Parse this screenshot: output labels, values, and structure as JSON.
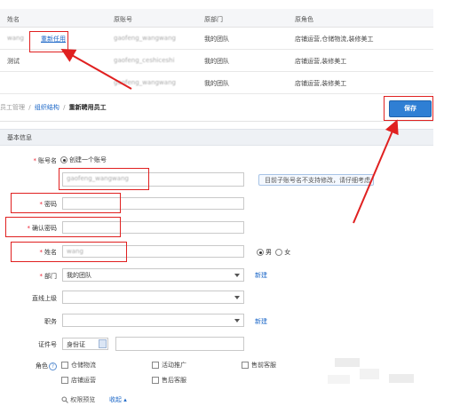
{
  "table": {
    "headers": [
      "姓名",
      "原账号",
      "原部门",
      "原角色"
    ],
    "rows": [
      {
        "name": "wang",
        "action": "重新任用",
        "account": "gaofeng_wangwang",
        "dept": "我的团队",
        "role": "店铺运营,仓储物流,装修美工"
      },
      {
        "name": "测试",
        "action": "",
        "account": "gaofeng_ceshiceshi",
        "dept": "我的团队",
        "role": "店铺运营,装修美工"
      },
      {
        "name": "",
        "action": "",
        "account": "gaofeng_wangwang",
        "dept": "我的团队",
        "role": "店铺运营,装修美工"
      }
    ]
  },
  "breadcrumb": {
    "items": [
      "员工管理",
      "组织结构",
      "重新聘用员工"
    ],
    "sep": "/"
  },
  "save_label": "保存",
  "section_title": "基本信息",
  "form": {
    "account_label": "账号名",
    "account_option": "创建一个账号",
    "account_value": "gaofeng_wangwang",
    "account_tip": "目前子账号名不支持修改，请仔细考虑",
    "password_label": "密码",
    "confirm_label": "确认密码",
    "name_label": "姓名",
    "name_value": "wang",
    "gender_male": "男",
    "gender_female": "女",
    "dept_label": "部门",
    "dept_value": "我的团队",
    "new_link": "新建",
    "superior_label": "直线上级",
    "position_label": "职务",
    "id_label": "证件号",
    "id_type": "身份证",
    "role_label": "角色",
    "roles": [
      "仓储物流",
      "活动推广",
      "售前客服",
      "店铺运营",
      "售后客服"
    ],
    "permission_preview": "权限预览",
    "collapse": "收起"
  }
}
